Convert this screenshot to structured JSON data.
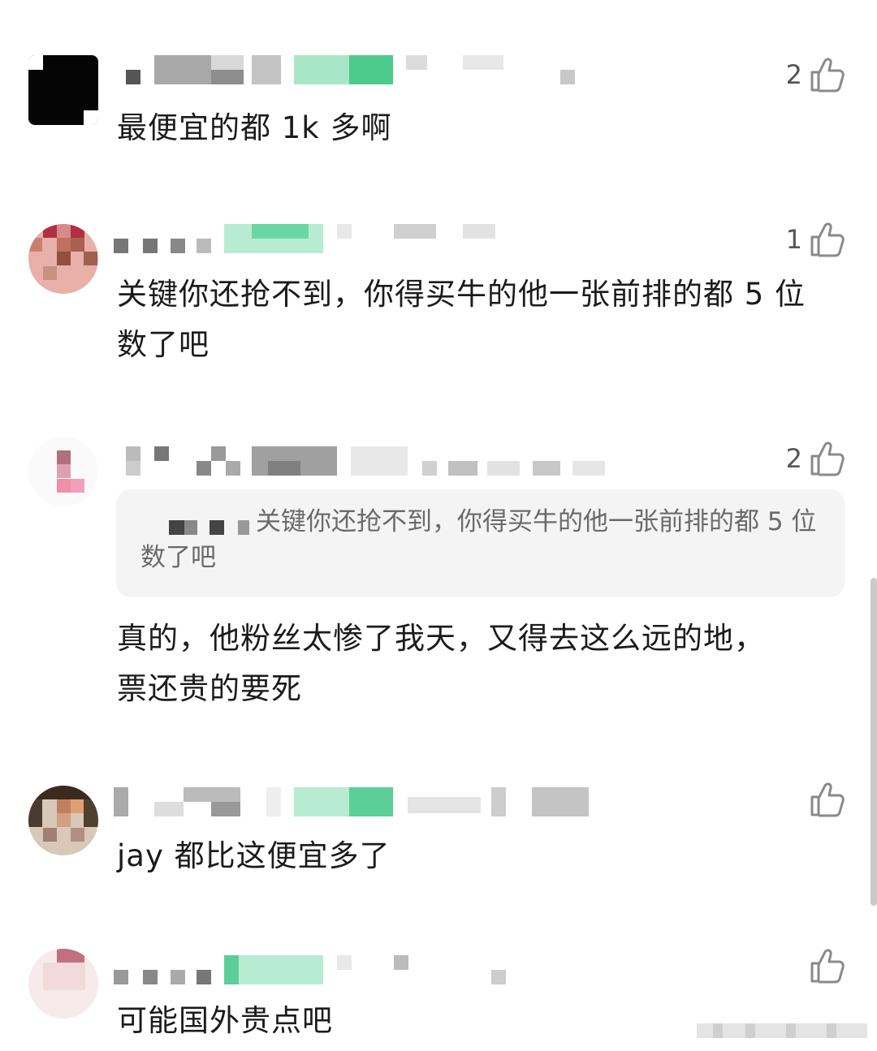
{
  "comments": [
    {
      "text": "最便宜的都 1k 多啊",
      "likes": "2"
    },
    {
      "text": "关键你还抢不到，你得买牛的他一张前排的都 5 位数了吧",
      "likes": "1"
    },
    {
      "quote": "关键你还抢不到，你得买牛的他一张前排的都 5 位数了吧",
      "text": "真的，他粉丝太惨了我天，又得去这么远的地，票还贵的要死",
      "likes": "2"
    },
    {
      "text": "jay 都比这便宜多了",
      "likes": ""
    },
    {
      "text": "可能国外贵点吧",
      "likes": ""
    }
  ],
  "icons": {
    "like": "thumbs-up-icon"
  },
  "colors": {
    "accent_green": "#5ccf98",
    "quote_bg": "#f4f4f4",
    "scrollbar": "#c9c9c9"
  }
}
